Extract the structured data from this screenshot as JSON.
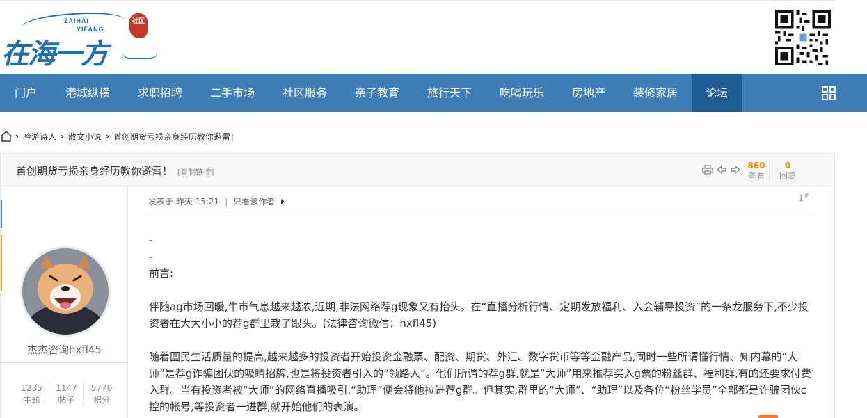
{
  "logo": {
    "title": "在海一方",
    "en_line1": "ZAIHAI",
    "en_line2": "YIFANG",
    "stamp": "社区"
  },
  "nav": {
    "items": [
      {
        "label": "门户"
      },
      {
        "label": "港城纵横"
      },
      {
        "label": "求职招聘"
      },
      {
        "label": "二手市场"
      },
      {
        "label": "社区服务"
      },
      {
        "label": "亲子教育"
      },
      {
        "label": "旅行天下"
      },
      {
        "label": "吃喝玩乐"
      },
      {
        "label": "房地产"
      },
      {
        "label": "装修家居"
      },
      {
        "label": "论坛"
      }
    ],
    "active": "论坛",
    "colors": {
      "bar": "#3e7db8",
      "active": "#1d5c94"
    }
  },
  "breadcrumb": [
    "吟游诗人",
    "散文小说",
    "首创期货亏损亲身经历教你避雷！"
  ],
  "thread": {
    "title": "首创期货亏损亲身经历教你避雷！",
    "copy_link": "[复制链接]",
    "views": "860",
    "views_label": "查看",
    "replies": "0",
    "replies_label": "回复"
  },
  "author": {
    "name": "杰杰咨询hxfl45",
    "stats": [
      {
        "num": "1235",
        "label": "主题"
      },
      {
        "num": "1147",
        "label": "帖子"
      },
      {
        "num": "5770",
        "label": "积分"
      }
    ]
  },
  "post": {
    "posted": "发表于 昨天 15:21",
    "only_author": "只看该作者",
    "floor": "1",
    "floor_mark": "#",
    "lines": [
      "-",
      "-",
      "前言:",
      "",
      "伴随ag市场回暖,牛市气息越来越浓,近期,非法网络荐g现象又有抬头。在“直播分析行情、定期发放福利、入会辅导投资”的一条龙服务下,不少投资者在大大小小的荐g群里栽了跟头。(法律咨询微信：hxfl45)",
      "",
      "随着国民生活质量的提高,越来越多的投资者开始投资金融票、配资、期货、外汇、数字货币等等金融产品,同时一些所谓懂行情、知内幕的“大师”是荐g诈骗团伙的吸睛招牌,也是将投资者引入的“领路人”。他们所谓的荐g群,就是“大师”用来推荐买入g票的粉丝群、福利群,有的还要求付费入群。当有投资者被“大师”的网络直播吸引,“助理”便会将他拉进荐g群。但其实,群里的“大师”、“助理”以及各位“粉丝学员”全部都是诈骗团伙c控的帐号,等投资者一进群,就开始他们的表演。"
    ]
  }
}
